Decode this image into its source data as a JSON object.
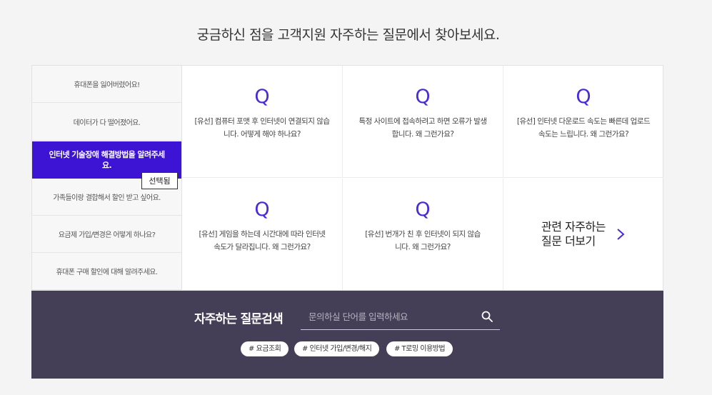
{
  "headline": "궁금하신 점을 고객지원 자주하는 질문에서 찾아보세요.",
  "categories": [
    {
      "label": "휴대폰을 잃어버렸어요!"
    },
    {
      "label": "데이터가 다 떨어졌어요."
    },
    {
      "label": "인터넷 기술장애 해결방법을 알려주세요."
    },
    {
      "label": "가족들이랑 결합해서 할인 받고 싶어요."
    },
    {
      "label": "요금제 가입/변경은 어떻게 하나요?"
    },
    {
      "label": "휴대폰 구매 할인에 대해 알려주세요."
    }
  ],
  "tooltip": "선택됨",
  "faq_cards": [
    {
      "icon": "Q",
      "question": "[유선] 컴퓨터 포맷 후 인터넷이 연결되지 않습니다. 어떻게 해야 하나요?"
    },
    {
      "icon": "Q",
      "question": "특정 사이트에 접속하려고 하면 오류가 발생합니다. 왜 그런가요?"
    },
    {
      "icon": "Q",
      "question": "[유선] 인터넷 다운로드 속도는 빠른데 업로드 속도는 느립니다. 왜 그런가요?"
    },
    {
      "icon": "Q",
      "question": "[유선] 게임을 하는데 시간대에 따라 인터넷 속도가 달라집니다. 왜 그런가요?"
    },
    {
      "icon": "Q",
      "question": "[유선] 번개가 친 후 인터넷이 되지 않습니다. 왜 그런가요?"
    }
  ],
  "more_link": {
    "line1": "관련 자주하는",
    "line2": "질문 더보기",
    "icon": "chevron-right-icon"
  },
  "search": {
    "label": "자주하는 질문검색",
    "placeholder": "문의하실 단어를 입력하세요",
    "icon": "search-icon"
  },
  "tags": [
    "# 요금조회",
    "# 인터넷 가입/변경/해지",
    "# T로밍 이용방법"
  ],
  "colors": {
    "accent": "#3d14d3",
    "q_icon": "#4a2ad6",
    "search_bg": "#443f56"
  }
}
